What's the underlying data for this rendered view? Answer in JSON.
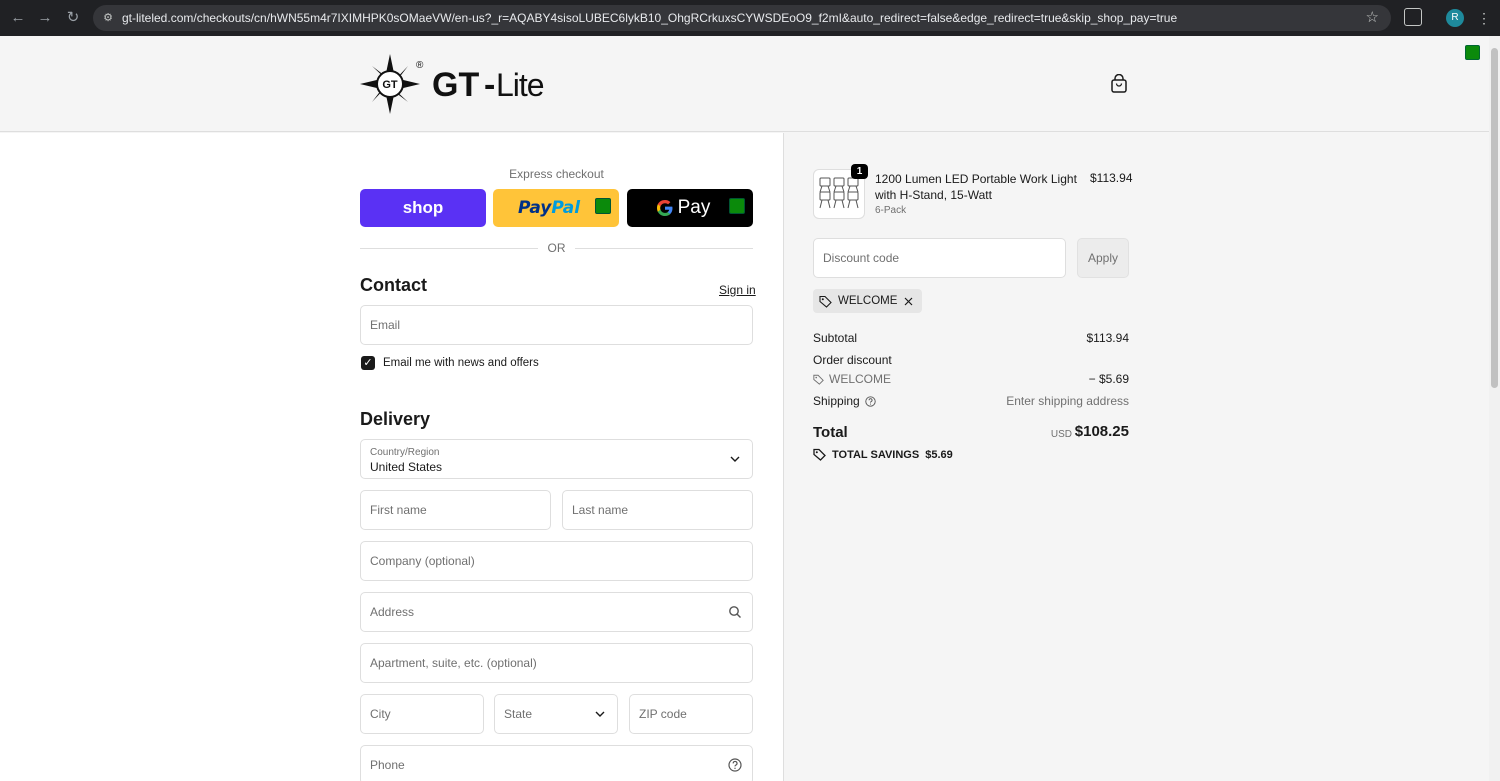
{
  "browser": {
    "url": "gt-liteled.com/checkouts/cn/hWN55m4r7IXIMHPK0sOMaeVW/en-us?_r=AQABY4sisoLUBEC6lykB10_OhgRCrkuxsCYWSDEoO9_f2mI&auto_redirect=false&edge_redirect=true&skip_shop_pay=true",
    "profile_initial": "R"
  },
  "header": {
    "logo_text_gt": "GT",
    "logo_text_dash": "-",
    "logo_text_lite": "Lite",
    "logo_badge": "GT",
    "logo_reg": "®"
  },
  "express": {
    "label": "Express checkout",
    "shop_label": "shop",
    "paypal_pay": "Pay",
    "paypal_pal": "Pal",
    "gpay_label": "Pay",
    "or_label": "OR"
  },
  "contact": {
    "title": "Contact",
    "sign_in": "Sign in",
    "email_placeholder": "Email",
    "newsletter_label": "Email me with news and offers",
    "newsletter_checked": true
  },
  "delivery": {
    "title": "Delivery",
    "country_label": "Country/Region",
    "country_value": "United States",
    "first_name": "First name",
    "last_name": "Last name",
    "company": "Company (optional)",
    "address": "Address",
    "apartment": "Apartment, suite, etc. (optional)",
    "city": "City",
    "state": "State",
    "zip": "ZIP code",
    "phone": "Phone"
  },
  "order": {
    "item": {
      "quantity": "1",
      "name": "1200 Lumen LED Portable Work Light with H-Stand, 15-Watt",
      "variant": "6-Pack",
      "price": "$113.94"
    },
    "discount_placeholder": "Discount code",
    "apply_label": "Apply",
    "applied_code": "WELCOME",
    "subtotal_label": "Subtotal",
    "subtotal_value": "$113.94",
    "order_discount_label": "Order discount",
    "discount_code": "WELCOME",
    "discount_value": "− $5.69",
    "shipping_label": "Shipping",
    "shipping_value": "Enter shipping address",
    "total_label": "Total",
    "currency": "USD",
    "total_value": "$108.25",
    "savings_label": "TOTAL SAVINGS",
    "savings_value": "$5.69"
  },
  "colors": {
    "shop_purple": "#5a31f4",
    "paypal_yellow": "#ffc439",
    "gpay_black": "#000000"
  }
}
